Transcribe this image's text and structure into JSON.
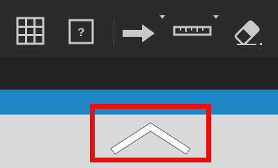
{
  "toolbar": {
    "buttons": [
      {
        "name": "grid",
        "icon": "grid-icon"
      },
      {
        "name": "help",
        "icon": "help-icon",
        "glyph": "?"
      },
      {
        "name": "arrow-tool",
        "icon": "arrow-right-icon",
        "has_dropdown": true
      },
      {
        "name": "ruler-tool",
        "icon": "ruler-icon",
        "has_dropdown": true
      },
      {
        "name": "eraser",
        "icon": "eraser-icon"
      }
    ],
    "icon_color": "#c9c9c9",
    "background_color": "#2b2b2b"
  },
  "content_band": {
    "background_color": "#212121"
  },
  "header_bar": {
    "background_color": "#1f86c6"
  },
  "panel": {
    "background_color": "#d9d9d9"
  },
  "collapse_handle": {
    "icon": "chevron-up-icon",
    "highlight_color": "#ee0c0c",
    "chevron_color": "#ffffff"
  }
}
